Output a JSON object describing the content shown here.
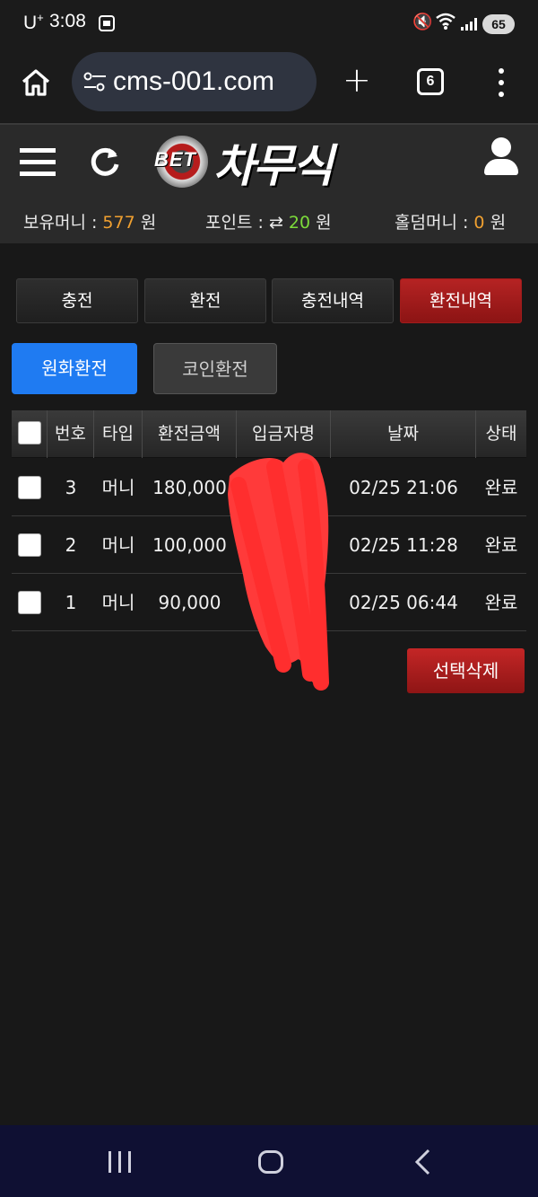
{
  "statusbar": {
    "carrier": "U",
    "carrier_sup": "+",
    "time": "3:08",
    "battery": "65"
  },
  "browser": {
    "url": "cms-001.com",
    "tabs_count": "6"
  },
  "site": {
    "logo_bet": "BET",
    "logo_name": "차무식",
    "balances": {
      "money_label": "보유머니 :",
      "money_value": "577",
      "money_unit": "원",
      "point_label": "포인트 :",
      "point_icon": "⇄",
      "point_value": "20",
      "point_unit": "원",
      "holdem_label": "홀덤머니 :",
      "holdem_value": "0",
      "holdem_unit": "원"
    }
  },
  "tabs": [
    {
      "label": "충전",
      "active": false
    },
    {
      "label": "환전",
      "active": false
    },
    {
      "label": "충전내역",
      "active": false
    },
    {
      "label": "환전내역",
      "active": true
    }
  ],
  "subtabs": {
    "primary": "원화환전",
    "secondary": "코인환전"
  },
  "table": {
    "headers": [
      "번호",
      "타입",
      "환전금액",
      "입금자명",
      "날짜",
      "상태"
    ],
    "rows": [
      {
        "no": "3",
        "type": "머니",
        "amount": "180,000",
        "name": "",
        "date": "02/25 21:06",
        "status": "완료"
      },
      {
        "no": "2",
        "type": "머니",
        "amount": "100,000",
        "name": "",
        "date": "02/25 11:28",
        "status": "완료"
      },
      {
        "no": "1",
        "type": "머니",
        "amount": "90,000",
        "name": "",
        "date": "02/25 06:44",
        "status": "완료"
      }
    ]
  },
  "actions": {
    "delete_selected": "선택삭제"
  },
  "colors": {
    "accent_red": "#b52323",
    "accent_blue": "#1f7bf2",
    "money_orange": "#f0a030",
    "point_green": "#7cdb3a",
    "redaction": "#ff3a3a"
  },
  "icons": [
    "home-icon",
    "tune-icon",
    "plus-icon",
    "tabs-icon",
    "more-vert-icon",
    "hamburger-icon",
    "refresh-icon",
    "user-icon",
    "recent-apps-icon",
    "nav-home-icon",
    "back-icon"
  ]
}
